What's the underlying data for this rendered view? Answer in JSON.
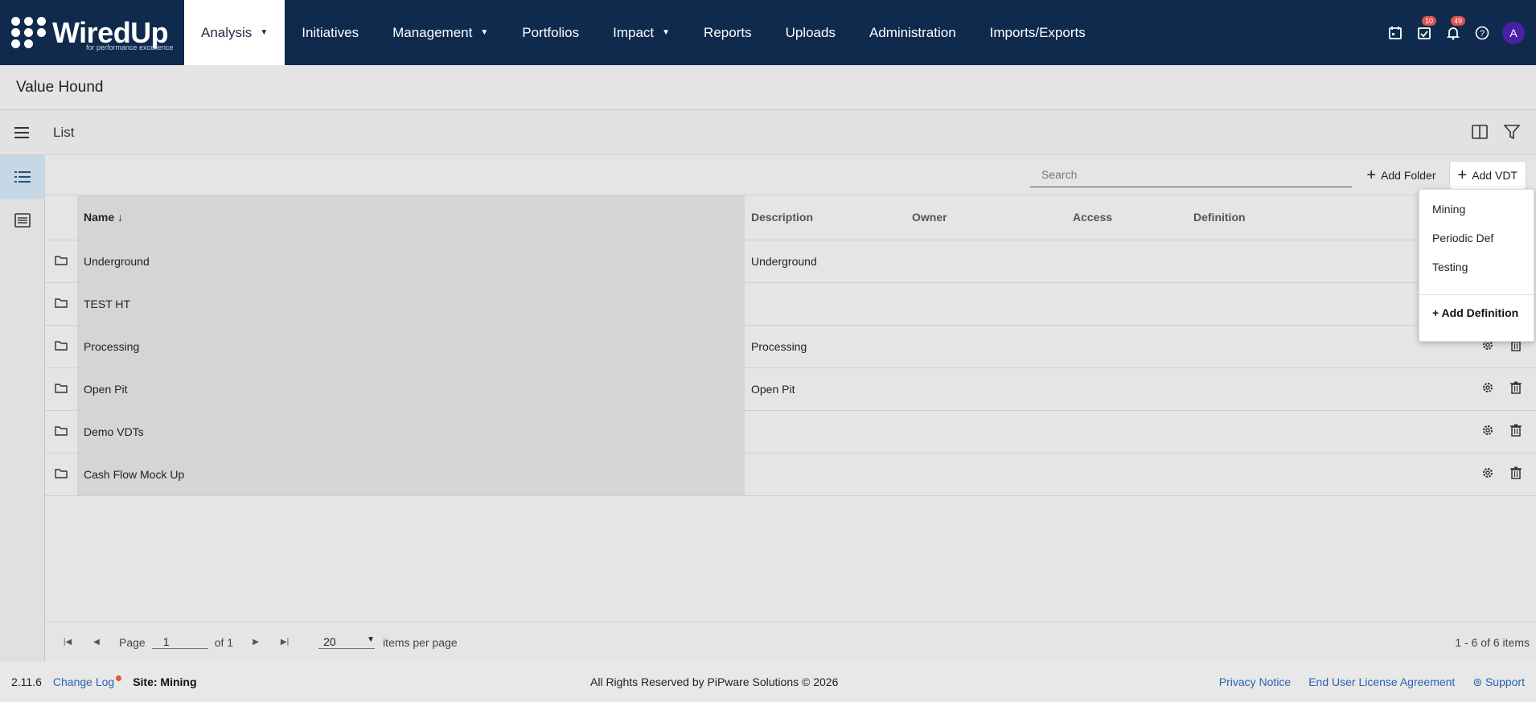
{
  "brand": {
    "name": "WiredUp",
    "tagline": "for performance excellence"
  },
  "nav": {
    "items": [
      {
        "label": "Analysis",
        "caret": true,
        "active": true
      },
      {
        "label": "Initiatives"
      },
      {
        "label": "Management",
        "caret": true
      },
      {
        "label": "Portfolios"
      },
      {
        "label": "Impact",
        "caret": true
      },
      {
        "label": "Reports"
      },
      {
        "label": "Uploads"
      },
      {
        "label": "Administration"
      },
      {
        "label": "Imports/Exports"
      }
    ],
    "tasks_badge": "10",
    "notifications_badge": "49",
    "avatar_initial": "A"
  },
  "page": {
    "title": "Value Hound"
  },
  "list": {
    "title": "List"
  },
  "toolbar": {
    "search_placeholder": "Search",
    "add_folder": "Add Folder",
    "add_vdt": "Add VDT"
  },
  "table": {
    "headers": {
      "name": "Name",
      "sort_arrow": "↓",
      "description": "Description",
      "owner": "Owner",
      "access": "Access",
      "definition": "Definition"
    },
    "rows": [
      {
        "name": "Underground",
        "description": "Underground"
      },
      {
        "name": "TEST HT",
        "description": ""
      },
      {
        "name": "Processing",
        "description": "Processing"
      },
      {
        "name": "Open Pit",
        "description": "Open Pit"
      },
      {
        "name": "Demo VDTs",
        "description": ""
      },
      {
        "name": "Cash Flow Mock Up",
        "description": ""
      }
    ]
  },
  "pager": {
    "page_label": "Page",
    "page": "1",
    "of": "of 1",
    "page_size": "20",
    "per_page": "items per page",
    "range": "1 - 6 of 6 items"
  },
  "dropdown": {
    "items": [
      "Mining",
      "Periodic Def",
      "Testing"
    ],
    "add_definition": "+ Add Definition"
  },
  "footer": {
    "version": "2.11.6",
    "changelog": "Change Log",
    "site": "Site: Mining",
    "copyright": "All Rights Reserved by PiPware Solutions © 2026",
    "privacy": "Privacy Notice",
    "eula": "End User License Agreement",
    "support": "Support"
  }
}
